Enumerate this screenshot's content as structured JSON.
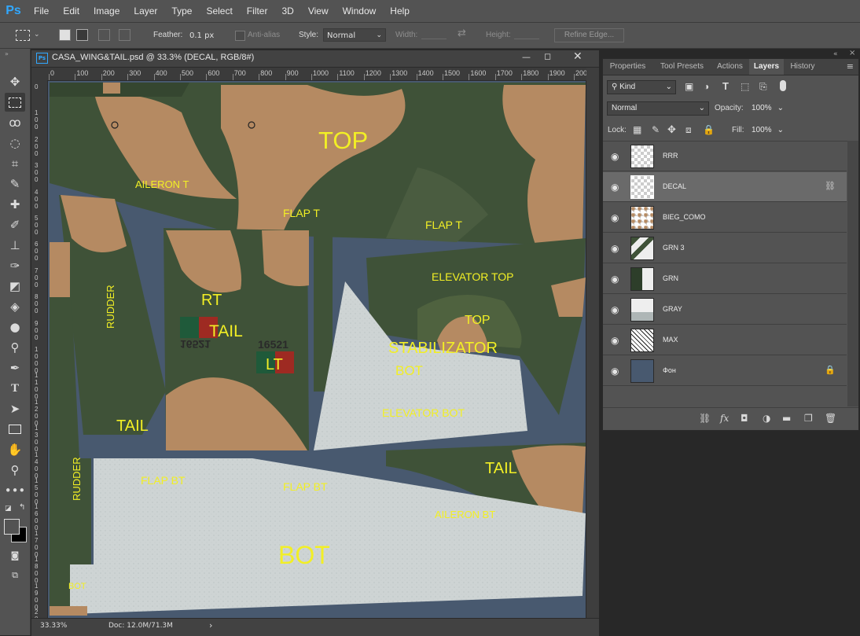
{
  "app": {
    "logo": "Ps"
  },
  "menu": [
    "File",
    "Edit",
    "Image",
    "Layer",
    "Type",
    "Select",
    "Filter",
    "3D",
    "View",
    "Window",
    "Help"
  ],
  "options": {
    "feather_label": "Feather:",
    "feather_value": "0.1 px",
    "antialias_label": "Anti-alias",
    "style_label": "Style:",
    "style_value": "Normal",
    "width_label": "Width:",
    "height_label": "Height:",
    "refine_edge": "Refine Edge..."
  },
  "document": {
    "title": "CASA_WING&TAIL.psd @ 33.3% (DECAL, RGB/8#)",
    "zoom": "33.33%",
    "doc_size": "Doc: 12.0M/71.3M"
  },
  "rulers": {
    "top": [
      "0",
      "100",
      "200",
      "300",
      "400",
      "500",
      "600",
      "700",
      "800",
      "900",
      "1000",
      "1100",
      "1200",
      "1300",
      "1400",
      "1500",
      "1600",
      "1700",
      "1800",
      "1900",
      "200"
    ],
    "left": [
      "0",
      "100",
      "200",
      "300",
      "400",
      "500",
      "600",
      "700",
      "800",
      "900",
      "1000",
      "1100",
      "1200",
      "1300",
      "1400",
      "1500",
      "1600",
      "1700",
      "1800",
      "1900",
      "2000"
    ]
  },
  "canvas_labels": {
    "top": "TOP",
    "aileron_t": "AILERON T",
    "flap_t_1": "FLAP T",
    "flap_t_2": "FLAP T",
    "elevator_top": "ELEVATOR TOP",
    "top_small": "TOP",
    "stabilizator": "STABILIZATOR",
    "bot_small": "BOT",
    "elevator_bot": "ELEVATOR BOT",
    "rudder_1": "RUDDER",
    "rt": "RT",
    "tail_1": "TAIL",
    "lt": "LT",
    "tail_2": "TAIL",
    "tail_3": "TAIL",
    "flap_bt_1": "FLAP BT",
    "flap_bt_2": "FLAP BT",
    "aileron_bt": "AILERON BT",
    "rudder_2": "RUDDER",
    "bot": "BOT",
    "bot_corner": "BOT",
    "serial_1": "16521",
    "serial_2": "16521"
  },
  "panel": {
    "tabs": [
      "Properties",
      "Tool Presets",
      "Actions",
      "Layers",
      "History"
    ],
    "active_tab": "Layers",
    "filter_kind": "Kind",
    "blend_mode": "Normal",
    "opacity_label": "Opacity:",
    "opacity_value": "100%",
    "lock_label": "Lock:",
    "fill_label": "Fill:",
    "fill_value": "100%"
  },
  "layers": [
    {
      "name": "RRR",
      "selected": false,
      "icon": ""
    },
    {
      "name": "DECAL",
      "selected": true,
      "icon": "link-icon"
    },
    {
      "name": "BIEG_COMO",
      "selected": false,
      "icon": ""
    },
    {
      "name": "GRN 3",
      "selected": false,
      "icon": ""
    },
    {
      "name": "GRN",
      "selected": false,
      "icon": ""
    },
    {
      "name": "GRAY",
      "selected": false,
      "icon": ""
    },
    {
      "name": "MAX",
      "selected": false,
      "icon": ""
    },
    {
      "name": "Фон",
      "selected": false,
      "icon": "lock-icon"
    }
  ],
  "colors": {
    "camo_green": "#3f5238",
    "camo_tan": "#b58a62",
    "bg_blue": "#48596f",
    "light_gray": "#c8cfcf",
    "label_yellow": "#f2ef25",
    "ps_blue": "#31a8ff"
  }
}
